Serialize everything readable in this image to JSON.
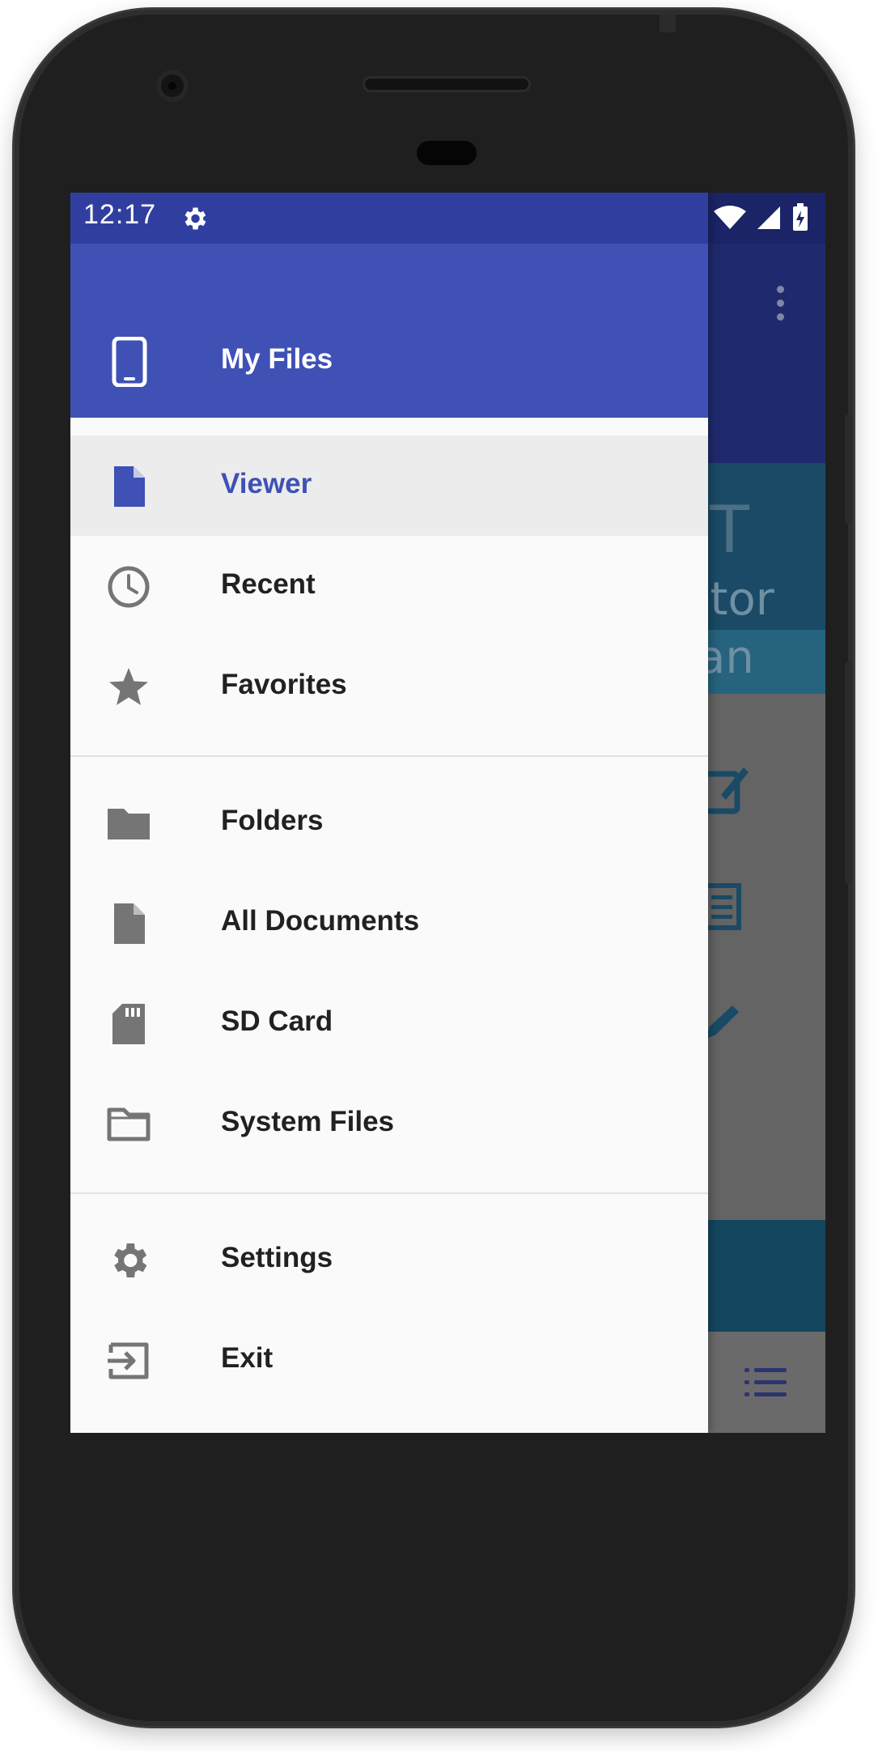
{
  "status_bar": {
    "time": "12:17"
  },
  "drawer": {
    "header": {
      "title": "My Files",
      "icon": "smartphone-icon"
    },
    "groups": [
      [
        {
          "label": "Viewer",
          "icon": "document-icon",
          "active": true
        },
        {
          "label": "Recent",
          "icon": "clock-icon",
          "active": false
        },
        {
          "label": "Favorites",
          "icon": "star-icon",
          "active": false
        }
      ],
      [
        {
          "label": "Folders",
          "icon": "folder-icon",
          "active": false
        },
        {
          "label": "All Documents",
          "icon": "file-icon",
          "active": false
        },
        {
          "label": "SD Card",
          "icon": "sd-card-icon",
          "active": false
        },
        {
          "label": "System Files",
          "icon": "folder-outline-icon",
          "active": false
        }
      ],
      [
        {
          "label": "Settings",
          "icon": "gear-icon",
          "active": false
        },
        {
          "label": "Exit",
          "icon": "exit-icon",
          "active": false
        }
      ]
    ]
  },
  "background_app": {
    "banner_text_1": "itor",
    "banner_text_2": "an",
    "banner_text_3": "T"
  },
  "colors": {
    "primary": "#3f51b5",
    "primary_dark": "#303f9f",
    "drawer_bg": "#fafafa",
    "active_bg": "#ececec",
    "icon_gray": "#757575",
    "text": "#212121"
  }
}
